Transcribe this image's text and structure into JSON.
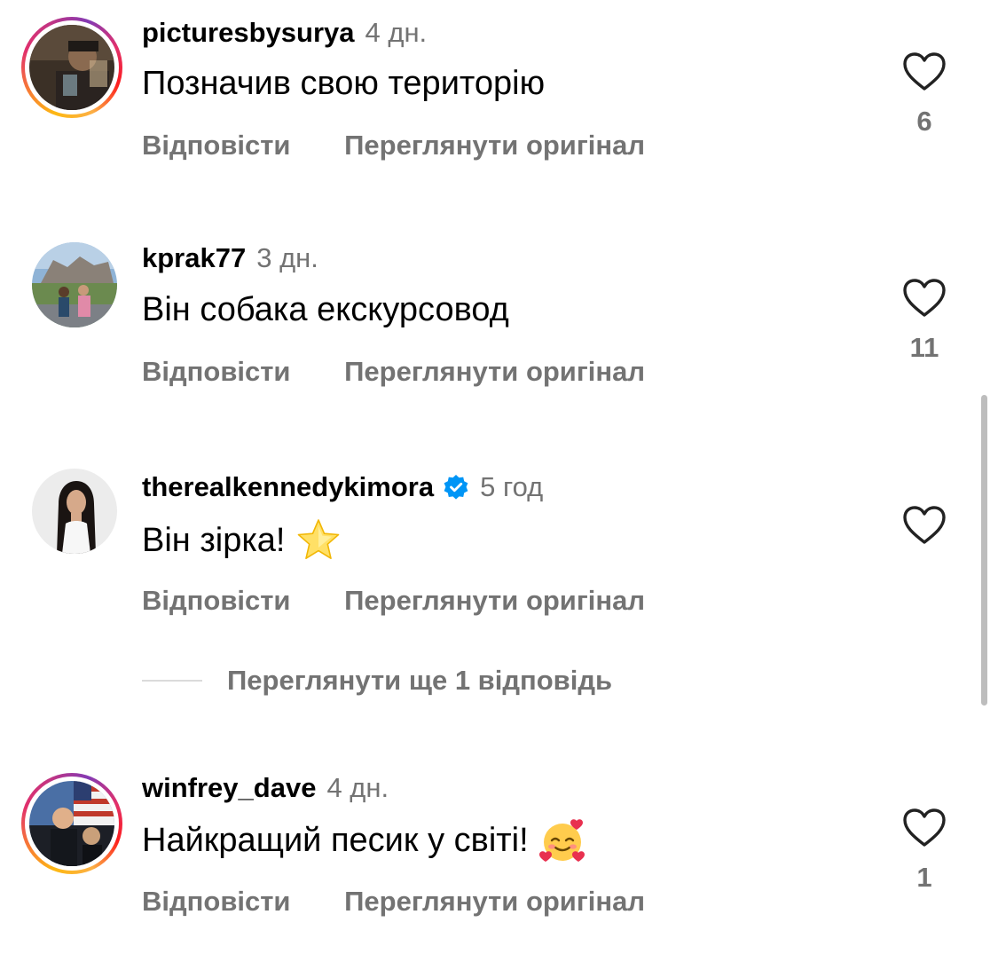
{
  "comments": [
    {
      "username": "picturesbysurya",
      "time": "4 дн.",
      "text": "Позначив свою територію",
      "verified": false,
      "story_ring": true,
      "reply_label": "Відповісти",
      "view_original_label": "Переглянути оригінал",
      "like_count": "6"
    },
    {
      "username": "kprak77",
      "time": "3 дн.",
      "text": "Він собака екскурсовод",
      "verified": false,
      "story_ring": false,
      "reply_label": "Відповісти",
      "view_original_label": "Переглянути оригінал",
      "like_count": "11"
    },
    {
      "username": "therealkennedykimora",
      "time": "5 год",
      "text": "Він зірка!",
      "verified": true,
      "story_ring": false,
      "emoji": "star",
      "reply_label": "Відповісти",
      "view_original_label": "Переглянути оригінал",
      "like_count": ""
    },
    {
      "username": "winfrey_dave",
      "time": "4 дн.",
      "text": "Найкращий песик у світі!",
      "verified": false,
      "story_ring": true,
      "emoji": "smiling-face-with-hearts",
      "reply_label": "Відповісти",
      "view_original_label": "Переглянути оригінал",
      "like_count": "1"
    }
  ],
  "view_more_replies": "Переглянути ще 1 відповідь",
  "colors": {
    "text_primary": "#000000",
    "text_secondary": "#737373",
    "verified_blue": "#0095f6",
    "divider": "#dbdbdb"
  },
  "icons": {
    "like": "heart-outline-icon",
    "verified": "verified-badge-icon"
  }
}
